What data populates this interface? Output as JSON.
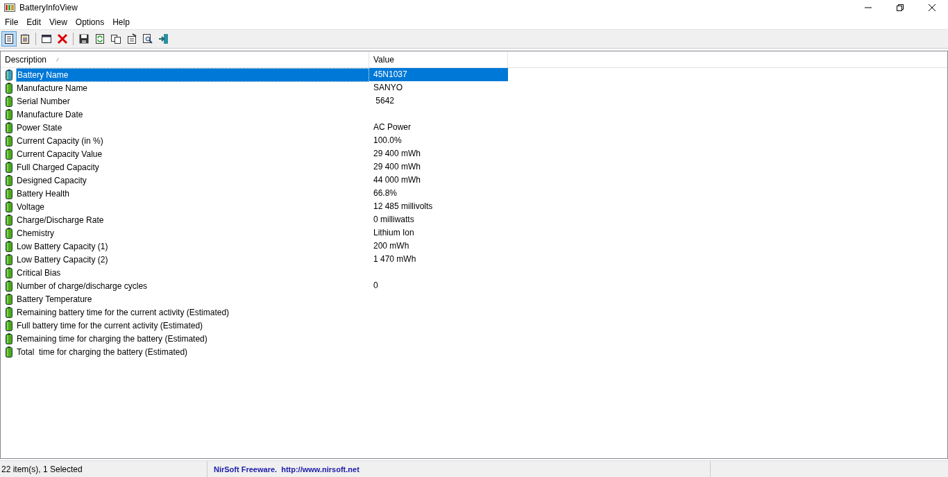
{
  "window": {
    "title": "BatteryInfoView"
  },
  "menu": [
    "File",
    "Edit",
    "View",
    "Options",
    "Help"
  ],
  "toolbar": [
    {
      "kind": "details",
      "selected": true
    },
    {
      "kind": "report",
      "selected": false
    },
    {
      "kind": "sep"
    },
    {
      "kind": "window",
      "selected": false
    },
    {
      "kind": "delete",
      "selected": false
    },
    {
      "kind": "sep"
    },
    {
      "kind": "save",
      "selected": false
    },
    {
      "kind": "refresh",
      "selected": false
    },
    {
      "kind": "copy",
      "selected": false
    },
    {
      "kind": "properties",
      "selected": false
    },
    {
      "kind": "find",
      "selected": false
    },
    {
      "kind": "exit",
      "selected": false
    }
  ],
  "table": {
    "columns": [
      "Description",
      "Value"
    ],
    "rows": [
      {
        "description": "Battery Name",
        "value": "45N1037",
        "selected": true
      },
      {
        "description": "Manufacture Name",
        "value": "SANYO",
        "selected": false
      },
      {
        "description": "Serial Number",
        "value": " 5642",
        "selected": false
      },
      {
        "description": "Manufacture Date",
        "value": "",
        "selected": false
      },
      {
        "description": "Power State",
        "value": "AC Power",
        "selected": false
      },
      {
        "description": "Current Capacity (in %)",
        "value": "100.0%",
        "selected": false
      },
      {
        "description": "Current Capacity Value",
        "value": "29 400 mWh",
        "selected": false
      },
      {
        "description": "Full Charged Capacity",
        "value": "29 400 mWh",
        "selected": false
      },
      {
        "description": "Designed Capacity",
        "value": "44 000 mWh",
        "selected": false
      },
      {
        "description": "Battery Health",
        "value": "66.8%",
        "selected": false
      },
      {
        "description": "Voltage",
        "value": "12 485 millivolts",
        "selected": false
      },
      {
        "description": "Charge/Discharge Rate",
        "value": "0 milliwatts",
        "selected": false
      },
      {
        "description": "Chemistry",
        "value": "Lithium Ion",
        "selected": false
      },
      {
        "description": "Low Battery Capacity (1)",
        "value": "200 mWh",
        "selected": false
      },
      {
        "description": "Low Battery Capacity (2)",
        "value": "1 470 mWh",
        "selected": false
      },
      {
        "description": "Critical Bias",
        "value": "",
        "selected": false
      },
      {
        "description": "Number of charge/discharge cycles",
        "value": "0",
        "selected": false
      },
      {
        "description": "Battery Temperature",
        "value": "",
        "selected": false
      },
      {
        "description": "Remaining battery time for the current activity (Estimated)",
        "value": "",
        "selected": false
      },
      {
        "description": "Full battery time for the current activity (Estimated)",
        "value": "",
        "selected": false
      },
      {
        "description": "Remaining time for charging the battery (Estimated)",
        "value": "",
        "selected": false
      },
      {
        "description": "Total  time for charging the battery (Estimated)",
        "value": "",
        "selected": false
      }
    ]
  },
  "status_bar": {
    "count": "22 item(s), 1 Selected",
    "credit": "NirSoft Freeware.  http://www.nirsoft.net"
  }
}
